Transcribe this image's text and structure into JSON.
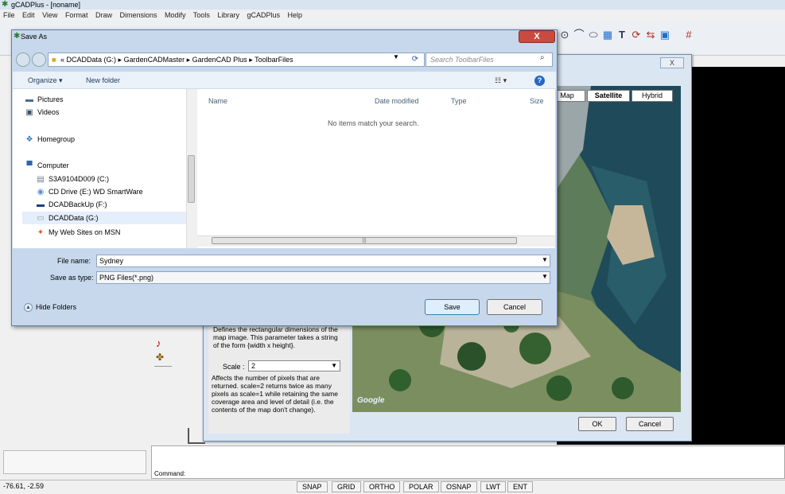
{
  "app": {
    "title": "gCADPlus - [noname]",
    "menu": [
      "File",
      "Edit",
      "View",
      "Format",
      "Draw",
      "Dimensions",
      "Modify",
      "Tools",
      "Library",
      "gCADPlus",
      "Help"
    ],
    "toolbar_icons": [
      "circle-icon",
      "arc-icon",
      "ellipse-icon",
      "hatch-icon",
      "text-icon",
      "rotate-icon",
      "move-icon",
      "block-icon",
      "grid-icon"
    ],
    "command_label": "Command:",
    "coords": "-76.61, -2.59",
    "status_buttons": [
      "SNAP",
      "GRID",
      "ORTHO",
      "POLAR",
      "OSNAP",
      "LWT",
      "ENT"
    ]
  },
  "map_dialog": {
    "close_label": "X",
    "map_types": [
      "Map",
      "Satellite",
      "Hybrid"
    ],
    "selected_map_type": "Satellite",
    "param_text": "Defines the rectangular dimensions of the map image. This parameter takes a string of the form {width x height}.",
    "scale_label": "Scale :",
    "scale_value": "2",
    "scale_desc": "Affects the number of pixels that are returned. scale=2 returns twice as many pixels as scale=1 while retaining the same coverage area and level of detail (i.e. the contents of the map don't change).",
    "ok_label": "OK",
    "cancel_label": "Cancel",
    "watermark": "Google"
  },
  "save_dialog": {
    "title": "Save As",
    "close_label": "X",
    "address": {
      "prefix": "«",
      "segments": [
        "DCADData (G:)",
        "GardenCADMaster",
        "GardenCAD Plus",
        "ToolbarFiles"
      ],
      "separator": "▸"
    },
    "search_placeholder": "Search ToolbarFiles",
    "organize_label": "Organize ▾",
    "new_folder_label": "New folder",
    "nav_items": [
      {
        "label": "Pictures",
        "icon": "pictures-icon"
      },
      {
        "label": "Videos",
        "icon": "videos-icon"
      },
      {
        "label": "Homegroup",
        "icon": "homegroup-icon"
      },
      {
        "label": "Computer",
        "icon": "computer-icon"
      },
      {
        "label": "S3A9104D009 (C:)",
        "icon": "drive-icon"
      },
      {
        "label": "CD Drive (E:) WD SmartWare",
        "icon": "cd-drive-icon"
      },
      {
        "label": "DCADBackUp (F:)",
        "icon": "drive-icon"
      },
      {
        "label": "DCADData (G:)",
        "icon": "drive-icon"
      },
      {
        "label": "My Web Sites on MSN",
        "icon": "msn-icon"
      }
    ],
    "selected_nav": "DCADData (G:)",
    "columns": [
      "Name",
      "Date modified",
      "Type",
      "Size"
    ],
    "empty_message": "No items match your search.",
    "file_name_label": "File name:",
    "file_name_value": "Sydney",
    "save_type_label": "Save as type:",
    "save_type_value": "PNG Files(*.png)",
    "hide_folders_label": "Hide Folders",
    "save_label": "Save",
    "cancel_label": "Cancel"
  }
}
